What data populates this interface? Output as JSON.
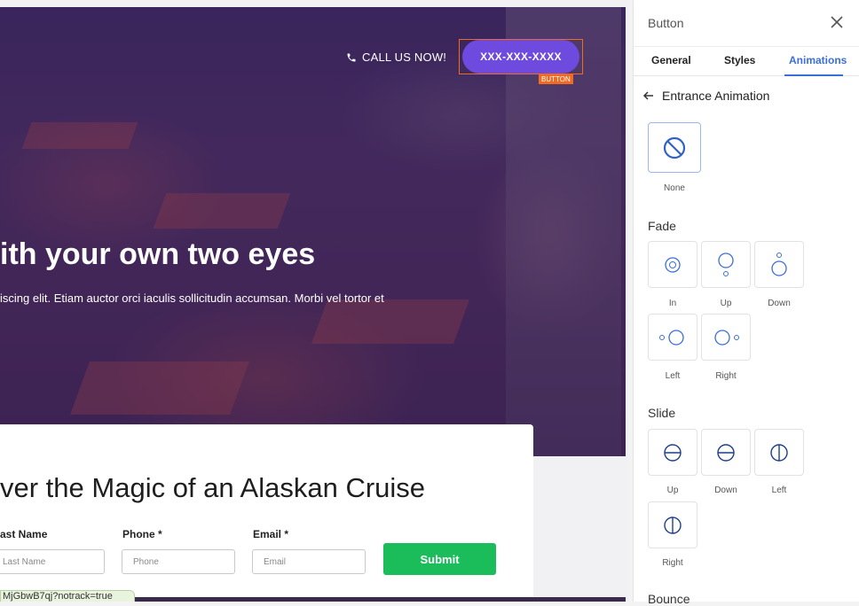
{
  "hero": {
    "call_text": "CALL US NOW!",
    "phone_button": "XXX-XXX-XXXX",
    "selection_tag": "BUTTON",
    "title": "ith your own two eyes",
    "subtitle": "iscing elit. Etiam auctor orci iaculis sollicitudin accumsan. Morbi vel tortor et"
  },
  "form": {
    "title": "ver the Magic of an Alaskan Cruise",
    "fields": [
      {
        "label": "ast Name",
        "placeholder": "Last Name"
      },
      {
        "label": "Phone *",
        "placeholder": "Phone"
      },
      {
        "label": "Email *",
        "placeholder": "Email"
      }
    ],
    "submit": "Submit"
  },
  "status_url": "MjGbwB7qj?notrack=true",
  "panel": {
    "title": "Button",
    "tabs": [
      "General",
      "Styles",
      "Animations"
    ],
    "active_tab": "Animations",
    "subheader": "Entrance Animation",
    "none_label": "None",
    "sections": [
      {
        "name": "Fade",
        "options": [
          "In",
          "Up",
          "Down",
          "Left",
          "Right"
        ]
      },
      {
        "name": "Slide",
        "options": [
          "Up",
          "Down",
          "Left",
          "Right"
        ]
      },
      {
        "name": "Bounce",
        "options": []
      }
    ]
  },
  "colors": {
    "accent": "#3b6fd8",
    "cta": "#6e4adf",
    "submit": "#1bbd5b",
    "selection": "#f06b22"
  }
}
